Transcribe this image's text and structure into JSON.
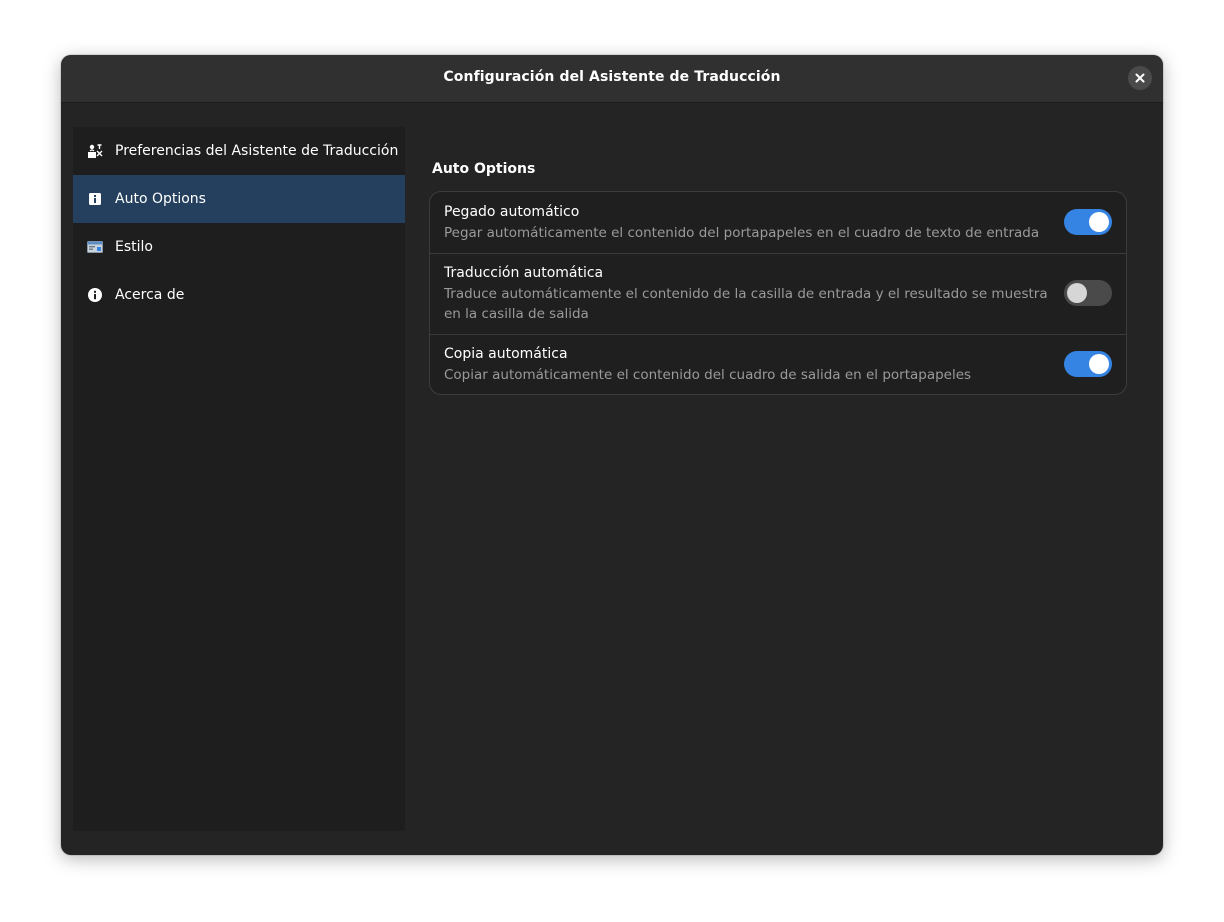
{
  "window": {
    "title": "Configuración del Asistente de Traducción"
  },
  "sidebar": {
    "items": [
      {
        "label": "Preferencias del Asistente de Traducción",
        "icon": "preferences-icon",
        "active": false
      },
      {
        "label": "Auto Options",
        "icon": "info-square-icon",
        "active": true
      },
      {
        "label": "Estilo",
        "icon": "style-icon",
        "active": false
      },
      {
        "label": "Acerca de",
        "icon": "info-circle-icon",
        "active": false
      }
    ]
  },
  "main": {
    "section_title": "Auto Options",
    "options": [
      {
        "title": "Pegado automático",
        "description": "Pegar automáticamente el contenido del portapapeles en el cuadro de texto de entrada",
        "enabled": true
      },
      {
        "title": "Traducción automática",
        "description": "Traduce automáticamente el contenido de la casilla de entrada y el resultado se muestra en la casilla de salida",
        "enabled": false
      },
      {
        "title": "Copia automática",
        "description": "Copiar automáticamente el contenido del cuadro de salida en el portapapeles",
        "enabled": true
      }
    ]
  },
  "colors": {
    "accent": "#3584e4",
    "active_sidebar": "#25405e",
    "window_bg": "#242424"
  }
}
